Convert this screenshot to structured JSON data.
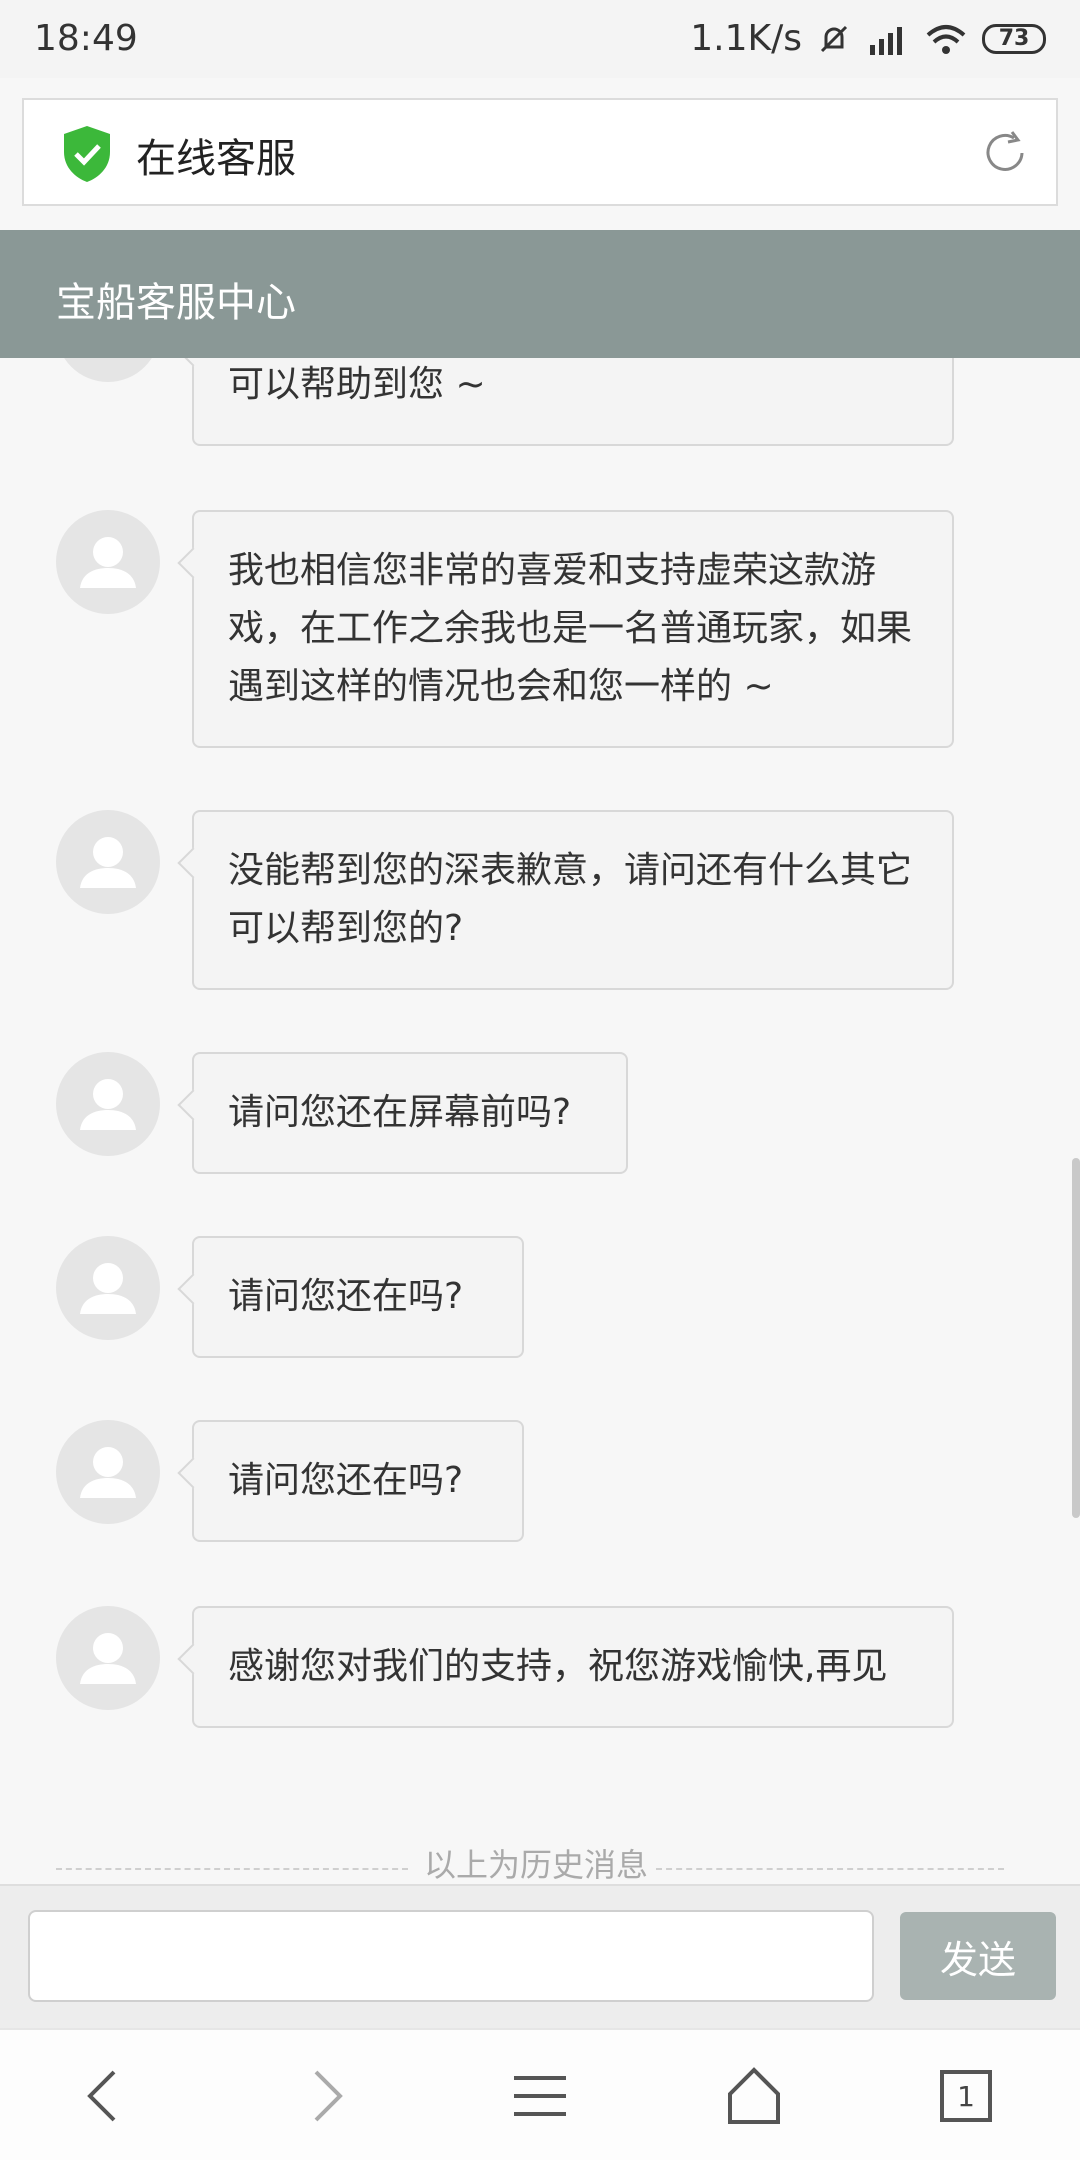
{
  "status_bar": {
    "time": "18:49",
    "network_speed": "1.1K/s",
    "battery": "73"
  },
  "browser": {
    "page_title": "在线客服"
  },
  "header": {
    "title": "宝船客服中心"
  },
  "messages": [
    {
      "text": "可以帮助到您 ~"
    },
    {
      "text": "我也相信您非常的喜爱和支持虚荣这款游戏，在工作之余我也是一名普通玩家，如果遇到这样的情况也会和您一样的 ~"
    },
    {
      "text": "没能帮到您的深表歉意，请问还有什么其它可以帮到您的?"
    },
    {
      "text": "请问您还在屏幕前吗?"
    },
    {
      "text": "请问您还在吗?"
    },
    {
      "text": "请问您还在吗?"
    },
    {
      "text": "感谢您对我们的支持，祝您游戏愉快,再见"
    }
  ],
  "history_divider": "以上为历史消息",
  "composer": {
    "placeholder": "",
    "send_label": "发送"
  },
  "nav": {
    "tabs_count": "1"
  },
  "colors": {
    "header_bg": "#8a9896",
    "shield_green": "#3cb83a",
    "send_bg": "#a9b3b1"
  },
  "icons": [
    "shield-check-icon",
    "reload-icon",
    "back-icon",
    "forward-icon",
    "menu-icon",
    "home-icon",
    "tabs-icon"
  ]
}
